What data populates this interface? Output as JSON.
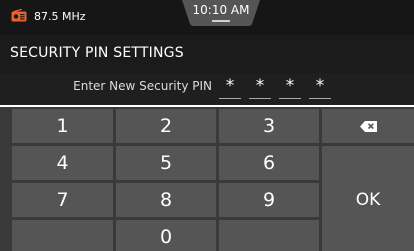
{
  "status_bar": {
    "frequency": "87.5 MHz",
    "time": "10:10 AM",
    "icons": {
      "source": "radio-icon"
    },
    "accent_color": "#e8622c"
  },
  "header": {
    "title": "SECURITY PIN SETTINGS"
  },
  "pin_entry": {
    "prompt": "Enter New Security PIN",
    "digits": [
      "*",
      "*",
      "*",
      "*"
    ]
  },
  "keypad": {
    "keys": [
      "1",
      "2",
      "3",
      "4",
      "5",
      "6",
      "7",
      "8",
      "9",
      "0"
    ],
    "backspace_icon": "backspace-icon",
    "ok_label": "OK"
  }
}
